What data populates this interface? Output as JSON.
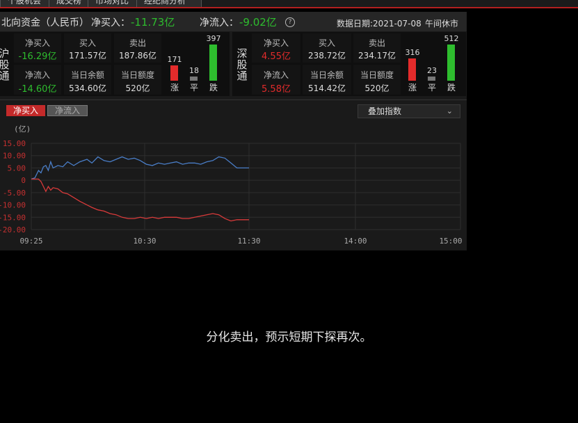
{
  "tabs": [
    "个股机会",
    "成交榜",
    "市场对比",
    "经纪商分析"
  ],
  "header": {
    "title": "北向资金（人民币）",
    "net_buy_label": "净买入：",
    "net_buy_value": "-11.73亿",
    "net_inflow_label": "净流入：",
    "net_inflow_value": "-9.02亿",
    "help_icon": "?",
    "date_label": "数据日期:2021-07-08",
    "status": "午间休市"
  },
  "shanghai": {
    "name": "沪股通",
    "net_buy_label": "净买入",
    "net_buy_value": "-16.29亿",
    "buy_label": "买入",
    "buy_value": "171.57亿",
    "sell_label": "卖出",
    "sell_value": "187.86亿",
    "net_inflow_label": "净流入",
    "net_inflow_value": "-14.60亿",
    "balance_label": "当日余额",
    "balance_value": "534.60亿",
    "quota_label": "当日额度",
    "quota_value": "520亿",
    "up_count": "171",
    "flat_count": "18",
    "down_count": "397",
    "up_label": "涨",
    "flat_label": "平",
    "down_label": "跌"
  },
  "shenzhen": {
    "name": "深股通",
    "net_buy_label": "净买入",
    "net_buy_value": "4.55亿",
    "buy_label": "买入",
    "buy_value": "238.72亿",
    "sell_label": "卖出",
    "sell_value": "234.17亿",
    "net_inflow_label": "净流入",
    "net_inflow_value": "5.58亿",
    "balance_label": "当日余额",
    "balance_value": "514.42亿",
    "quota_label": "当日额度",
    "quota_value": "520亿",
    "up_count": "316",
    "flat_count": "23",
    "down_count": "512",
    "up_label": "涨",
    "flat_label": "平",
    "down_label": "跌"
  },
  "chart_controls": {
    "tab_active": "净买入",
    "tab_inactive": "净流入",
    "overlay_dropdown": "叠加指数",
    "dropdown_icon": "chevron-down-icon"
  },
  "colors": {
    "up": "#e32b2b",
    "down": "#2ebd2e",
    "accent": "#b32020",
    "blue_line": "#4a7ec8",
    "red_line": "#d93a3a"
  },
  "caption": "分化卖出，预示短期下探再次。",
  "chart_data": {
    "type": "line",
    "ylabel": "(亿)",
    "ylim": [
      -20,
      15
    ],
    "yticks": [
      "15.00",
      "10.00",
      "5.00",
      "0",
      "-5.00",
      "-10.00",
      "-15.00",
      "-20.00"
    ],
    "xticks": [
      "09:25",
      "10:30",
      "11:30",
      "14:00",
      "15:00"
    ],
    "grid": true,
    "series": [
      {
        "name": "",
        "color": "#4a7ec8",
        "x": [
          0,
          3,
          6,
          8,
          10,
          12,
          14,
          16,
          18,
          22,
          26,
          30,
          35,
          40,
          46,
          50,
          55,
          60,
          65,
          70,
          75,
          80,
          85,
          90,
          95,
          100,
          105,
          110,
          115,
          120,
          125,
          130,
          135,
          140,
          145,
          150,
          155,
          160,
          165,
          170,
          175,
          180
        ],
        "values": [
          0.5,
          1.0,
          4.0,
          3.0,
          5.5,
          6.0,
          4.0,
          7.5,
          5.0,
          6.0,
          5.5,
          7.5,
          6.0,
          7.5,
          8.5,
          7.0,
          9.5,
          8.0,
          7.5,
          8.5,
          9.5,
          8.5,
          9.0,
          8.0,
          6.5,
          6.0,
          7.0,
          6.5,
          7.0,
          7.5,
          6.5,
          7.0,
          7.0,
          6.5,
          7.5,
          8.0,
          9.5,
          9.0,
          7.0,
          5.0,
          5.0,
          5.0
        ]
      },
      {
        "name": "",
        "color": "#d93a3a",
        "x": [
          0,
          3,
          6,
          8,
          10,
          12,
          14,
          16,
          18,
          22,
          26,
          30,
          35,
          40,
          46,
          50,
          55,
          60,
          65,
          70,
          75,
          80,
          85,
          90,
          95,
          100,
          105,
          110,
          115,
          120,
          125,
          130,
          135,
          140,
          145,
          150,
          155,
          160,
          165,
          170,
          175,
          180
        ],
        "values": [
          0.5,
          0.5,
          0.5,
          -0.5,
          -2.5,
          -4.5,
          -2.5,
          -4.0,
          -3.0,
          -3.5,
          -5.0,
          -5.5,
          -7.0,
          -8.5,
          -10.0,
          -11.0,
          -12.0,
          -12.5,
          -13.5,
          -14.0,
          -15.0,
          -15.5,
          -15.5,
          -15.0,
          -15.5,
          -15.0,
          -15.5,
          -15.0,
          -15.0,
          -15.0,
          -15.5,
          -15.5,
          -15.0,
          -14.5,
          -14.0,
          -13.5,
          -14.0,
          -15.5,
          -16.5,
          -16.0,
          -16.0,
          -16.0
        ]
      }
    ]
  }
}
